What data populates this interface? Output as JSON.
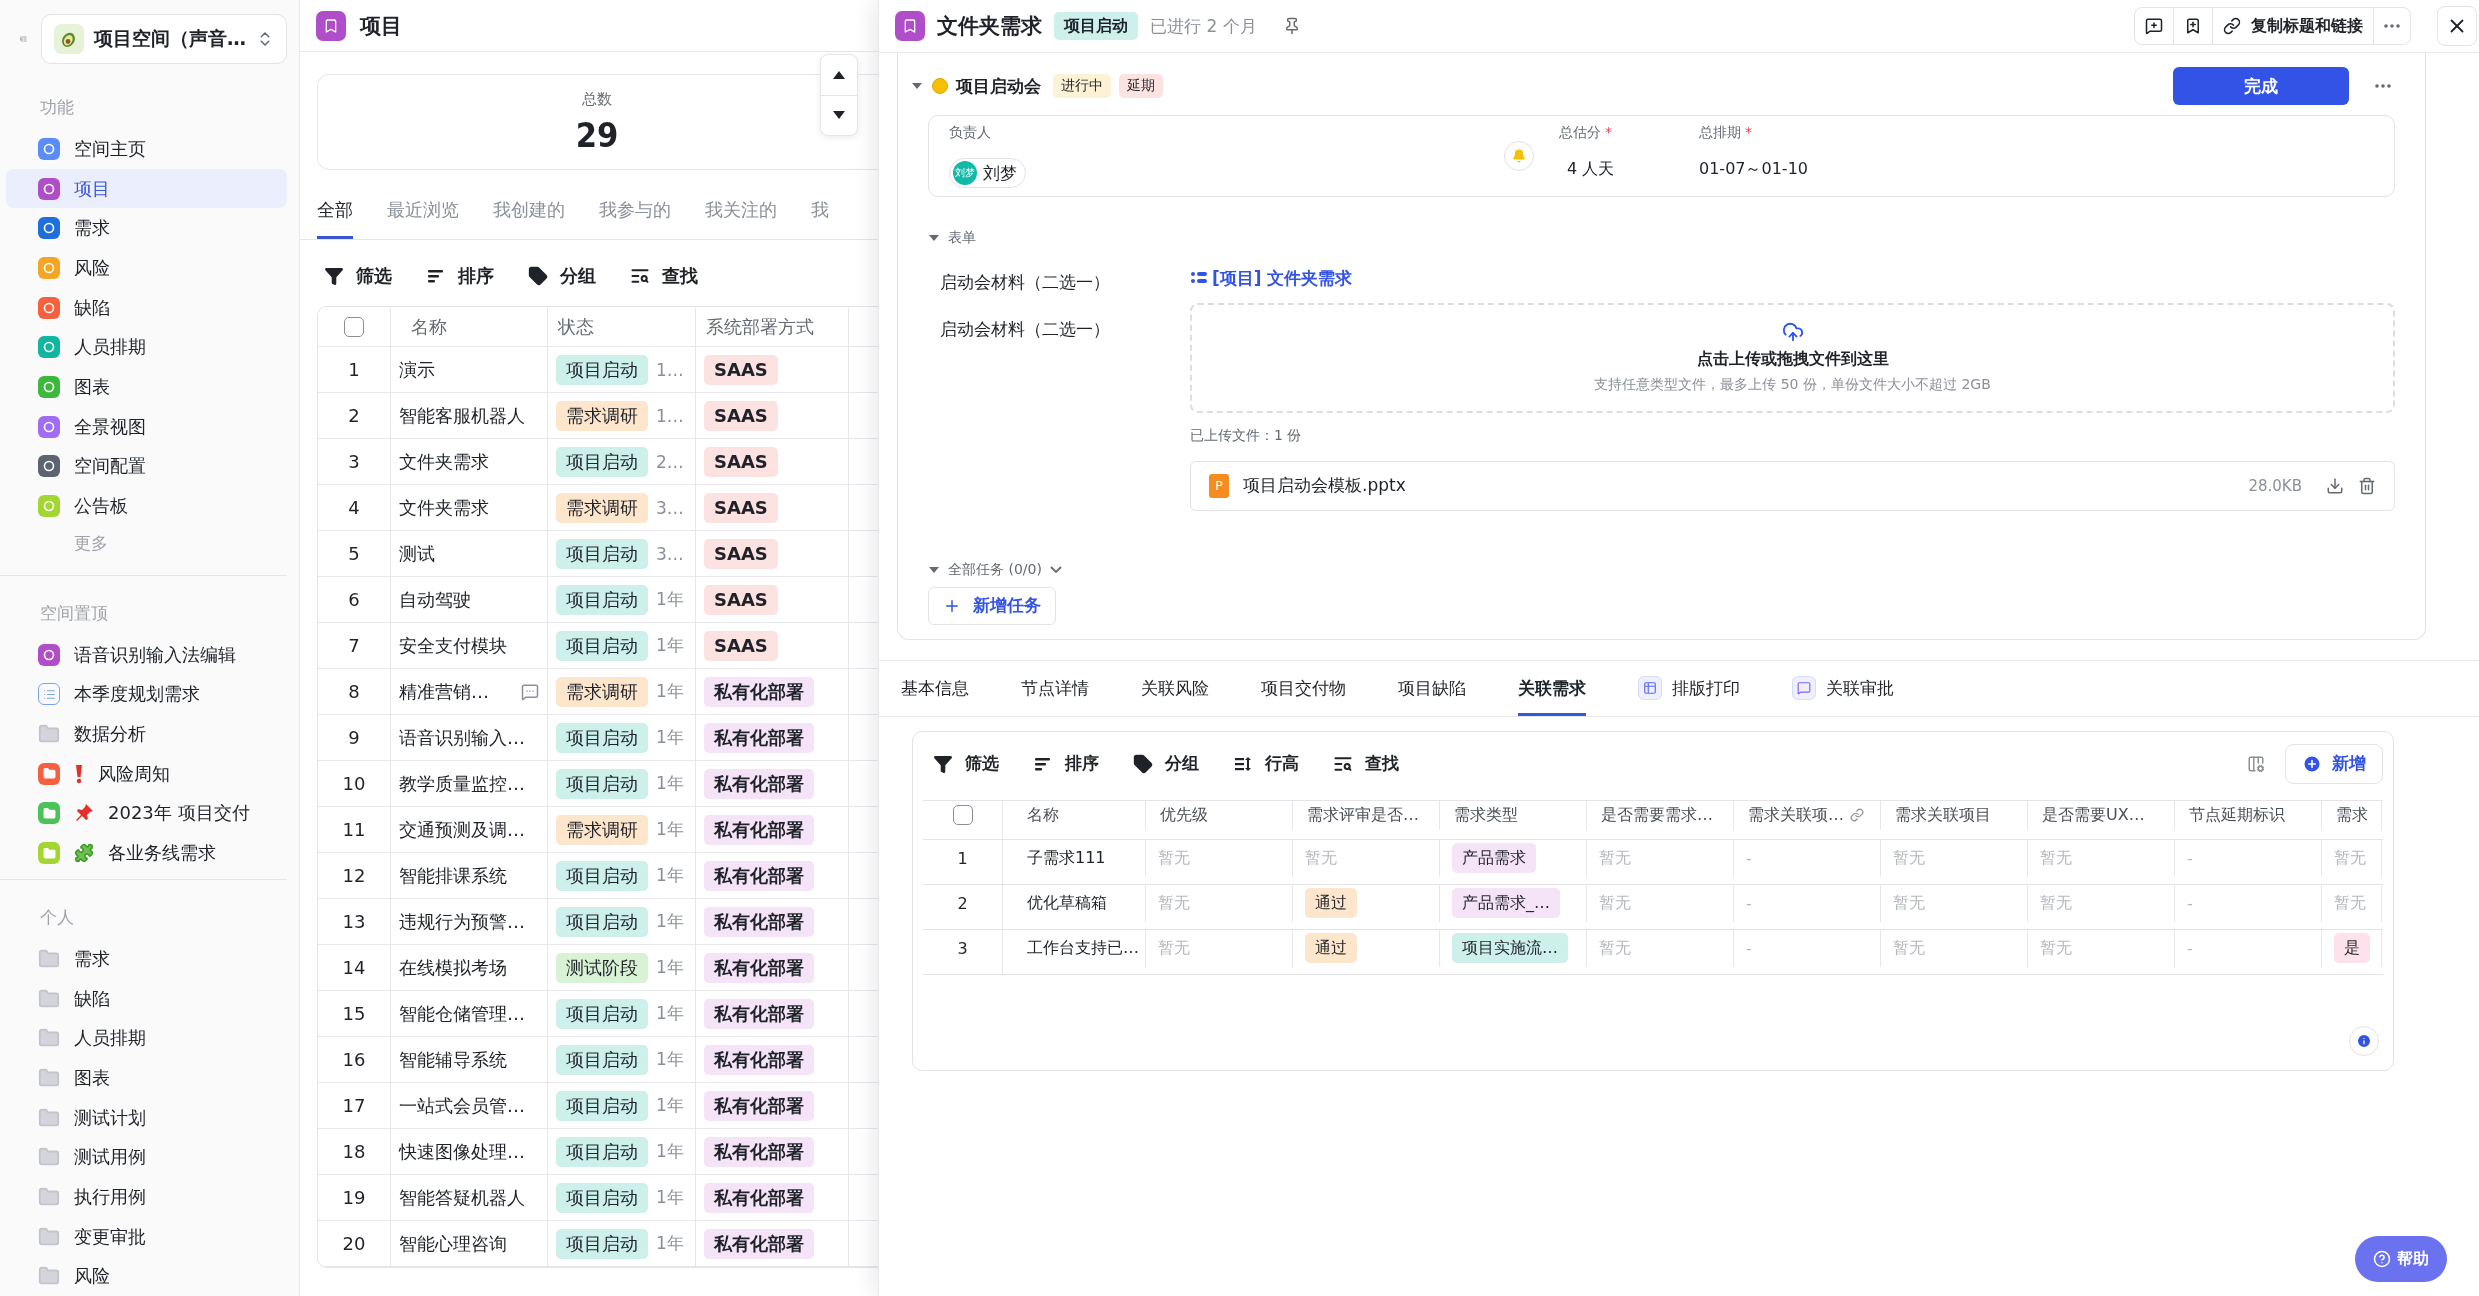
{
  "sidebar": {
    "space_selector": "项目空间（声音…",
    "sections": [
      {
        "title": "功能",
        "more": "更多",
        "items": [
          {
            "label": "空间主页",
            "kind": "app",
            "color": "#5b8cf7",
            "selected": false
          },
          {
            "label": "项目",
            "kind": "app",
            "color": "#b04ec9",
            "selected": true
          },
          {
            "label": "需求",
            "kind": "app",
            "color": "#1e6fd9",
            "selected": false
          },
          {
            "label": "风险",
            "kind": "app",
            "color": "#f5a524",
            "selected": false
          },
          {
            "label": "缺陷",
            "kind": "app",
            "color": "#f5603f",
            "selected": false
          },
          {
            "label": "人员排期",
            "kind": "app",
            "color": "#12b5a0",
            "selected": false
          },
          {
            "label": "图表",
            "kind": "app",
            "color": "#3cb93c",
            "selected": false
          },
          {
            "label": "全景视图",
            "kind": "app",
            "color": "#a06cf2",
            "selected": false
          },
          {
            "label": "空间配置",
            "kind": "app",
            "color": "#5d6470",
            "selected": false
          },
          {
            "label": "公告板",
            "kind": "app",
            "color": "#a3d631",
            "selected": false
          }
        ]
      },
      {
        "title": "空间置顶",
        "items": [
          {
            "label": "语音识别输入法编辑",
            "kind": "app",
            "color": "#b04ec9",
            "selected": false
          },
          {
            "label": "本季度规划需求",
            "kind": "list",
            "selected": false
          },
          {
            "label": "数据分析",
            "kind": "folder",
            "selected": false
          },
          {
            "label": "风险周知",
            "kind": "alert-folder",
            "color": "#f5603f",
            "selected": false
          },
          {
            "label": "2023年 项目交付",
            "kind": "pin-folder",
            "color": "#4cc25a",
            "selected": false
          },
          {
            "label": "各业务线需求",
            "kind": "puzzle-folder",
            "color": "#a3d631",
            "selected": false
          }
        ]
      },
      {
        "title": "个人",
        "items": [
          {
            "label": "需求",
            "kind": "folder",
            "selected": false
          },
          {
            "label": "缺陷",
            "kind": "folder",
            "selected": false
          },
          {
            "label": "人员排期",
            "kind": "folder",
            "selected": false
          },
          {
            "label": "图表",
            "kind": "folder",
            "selected": false
          },
          {
            "label": "测试计划",
            "kind": "folder",
            "selected": false
          },
          {
            "label": "测试用例",
            "kind": "folder",
            "selected": false
          },
          {
            "label": "执行用例",
            "kind": "folder",
            "selected": false
          },
          {
            "label": "变更审批",
            "kind": "folder",
            "selected": false
          },
          {
            "label": "风险",
            "kind": "folder",
            "selected": false
          }
        ]
      }
    ]
  },
  "project_list": {
    "title": "项目",
    "total_label": "总数",
    "total": "29",
    "tabs": [
      {
        "label": "全部",
        "selected": true
      },
      {
        "label": "最近浏览",
        "selected": false
      },
      {
        "label": "我创建的",
        "selected": false
      },
      {
        "label": "我参与的",
        "selected": false
      },
      {
        "label": "我关注的",
        "selected": false
      },
      {
        "label": "我",
        "selected": false
      }
    ],
    "toolbar": [
      {
        "label": "筛选",
        "kind": "filter"
      },
      {
        "label": "排序",
        "kind": "sort"
      },
      {
        "label": "分组",
        "kind": "group"
      },
      {
        "label": "查找",
        "kind": "find"
      }
    ],
    "table": {
      "all_checked": false,
      "columns": [
        "名称",
        "状态",
        "系统部署方式"
      ],
      "rows": [
        {
          "index": "1",
          "name": "演示",
          "commented": false,
          "status": {
            "label": "项目启动",
            "color": "#cdf0ea"
          },
          "duration": "1…",
          "deploy": {
            "label": "SAAS",
            "color": "#fde2e2"
          }
        },
        {
          "index": "2",
          "name": "智能客服机器人",
          "commented": false,
          "status": {
            "label": "需求调研",
            "color": "#fde6cc"
          },
          "duration": "1…",
          "deploy": {
            "label": "SAAS",
            "color": "#fde2e2"
          }
        },
        {
          "index": "3",
          "name": "文件夹需求",
          "commented": false,
          "status": {
            "label": "项目启动",
            "color": "#cdf0ea"
          },
          "duration": "2…",
          "deploy": {
            "label": "SAAS",
            "color": "#fde2e2"
          }
        },
        {
          "index": "4",
          "name": "文件夹需求",
          "commented": false,
          "status": {
            "label": "需求调研",
            "color": "#fde6cc"
          },
          "duration": "3…",
          "deploy": {
            "label": "SAAS",
            "color": "#fde2e2"
          }
        },
        {
          "index": "5",
          "name": "测试",
          "commented": false,
          "status": {
            "label": "项目启动",
            "color": "#cdf0ea"
          },
          "duration": "3…",
          "deploy": {
            "label": "SAAS",
            "color": "#fde2e2"
          }
        },
        {
          "index": "6",
          "name": "自动驾驶",
          "commented": false,
          "status": {
            "label": "项目启动",
            "color": "#cdf0ea"
          },
          "duration": "1年",
          "deploy": {
            "label": "SAAS",
            "color": "#fde2e2"
          }
        },
        {
          "index": "7",
          "name": "安全支付模块",
          "commented": false,
          "status": {
            "label": "项目启动",
            "color": "#cdf0ea"
          },
          "duration": "1年",
          "deploy": {
            "label": "SAAS",
            "color": "#fde2e2"
          }
        },
        {
          "index": "8",
          "name": "精准营销…",
          "commented": true,
          "status": {
            "label": "需求调研",
            "color": "#fde6cc"
          },
          "duration": "1年",
          "deploy": {
            "label": "私有化部署",
            "color": "#f5e3f7"
          }
        },
        {
          "index": "9",
          "name": "语音识别输入…",
          "commented": false,
          "status": {
            "label": "项目启动",
            "color": "#cdf0ea"
          },
          "duration": "1年",
          "deploy": {
            "label": "私有化部署",
            "color": "#f5e3f7"
          }
        },
        {
          "index": "10",
          "name": "教学质量监控…",
          "commented": false,
          "status": {
            "label": "项目启动",
            "color": "#cdf0ea"
          },
          "duration": "1年",
          "deploy": {
            "label": "私有化部署",
            "color": "#f5e3f7"
          }
        },
        {
          "index": "11",
          "name": "交通预测及调…",
          "commented": false,
          "status": {
            "label": "需求调研",
            "color": "#fde6cc"
          },
          "duration": "1年",
          "deploy": {
            "label": "私有化部署",
            "color": "#f5e3f7"
          }
        },
        {
          "index": "12",
          "name": "智能排课系统",
          "commented": false,
          "status": {
            "label": "项目启动",
            "color": "#cdf0ea"
          },
          "duration": "1年",
          "deploy": {
            "label": "私有化部署",
            "color": "#f5e3f7"
          }
        },
        {
          "index": "13",
          "name": "违规行为预警…",
          "commented": false,
          "status": {
            "label": "项目启动",
            "color": "#cdf0ea"
          },
          "duration": "1年",
          "deploy": {
            "label": "私有化部署",
            "color": "#f5e3f7"
          }
        },
        {
          "index": "14",
          "name": "在线模拟考场",
          "commented": false,
          "status": {
            "label": "测试阶段",
            "color": "#d9f2d5"
          },
          "duration": "1年",
          "deploy": {
            "label": "私有化部署",
            "color": "#f5e3f7"
          }
        },
        {
          "index": "15",
          "name": "智能仓储管理…",
          "commented": false,
          "status": {
            "label": "项目启动",
            "color": "#cdf0ea"
          },
          "duration": "1年",
          "deploy": {
            "label": "私有化部署",
            "color": "#f5e3f7"
          }
        },
        {
          "index": "16",
          "name": "智能辅导系统",
          "commented": false,
          "status": {
            "label": "项目启动",
            "color": "#cdf0ea"
          },
          "duration": "1年",
          "deploy": {
            "label": "私有化部署",
            "color": "#f5e3f7"
          }
        },
        {
          "index": "17",
          "name": "一站式会员管…",
          "commented": false,
          "status": {
            "label": "项目启动",
            "color": "#cdf0ea"
          },
          "duration": "1年",
          "deploy": {
            "label": "私有化部署",
            "color": "#f5e3f7"
          }
        },
        {
          "index": "18",
          "name": "快速图像处理…",
          "commented": false,
          "status": {
            "label": "项目启动",
            "color": "#cdf0ea"
          },
          "duration": "1年",
          "deploy": {
            "label": "私有化部署",
            "color": "#f5e3f7"
          }
        },
        {
          "index": "19",
          "name": "智能答疑机器人",
          "commented": false,
          "status": {
            "label": "项目启动",
            "color": "#cdf0ea"
          },
          "duration": "1年",
          "deploy": {
            "label": "私有化部署",
            "color": "#f5e3f7"
          }
        },
        {
          "index": "20",
          "name": "智能心理咨询",
          "commented": false,
          "status": {
            "label": "项目启动",
            "color": "#cdf0ea"
          },
          "duration": "1年",
          "deploy": {
            "label": "私有化部署",
            "color": "#f5e3f7"
          }
        }
      ]
    }
  },
  "detail": {
    "title": "文件夹需求",
    "status_tag": "项目启动",
    "elapsed": "已进行 2 个月",
    "copy_button": "复制标题和链接",
    "node": {
      "name": "项目启动会",
      "tags": [
        {
          "label": "进行中",
          "color": "#fdf1d6"
        },
        {
          "label": "延期",
          "color": "#fde2e2"
        }
      ],
      "complete_button": "完成",
      "owner_label": "负责人",
      "owner": "刘梦",
      "owner_avatar": "刘梦",
      "fields": [
        {
          "label": "总估分",
          "mark": "*",
          "value": "4 人天"
        },
        {
          "label": "总排期",
          "mark": "*",
          "value": "01-07～01-10"
        }
      ],
      "form_section": "表单",
      "form_labels": [
        "启动会材料（二选一）",
        "启动会材料（二选一）"
      ],
      "link": "[项目] 文件夹需求",
      "upload_title": "点击上传或拖拽文件到这里",
      "upload_hint": "支持任意类型文件，最多上传 50 份，单份文件大小不超过 2GB",
      "uploaded_label": "已上传文件：1 份",
      "file": {
        "badge": "P",
        "name": "项目启动会模板.pptx",
        "size": "28.0KB"
      },
      "tasks_label": "全部任务 (0/0)",
      "add_task": "新增任务"
    },
    "tabs": [
      {
        "label": "基本信息",
        "kind": "plain",
        "selected": false
      },
      {
        "label": "节点详情",
        "kind": "plain",
        "selected": false
      },
      {
        "label": "关联风险",
        "kind": "plain",
        "selected": false
      },
      {
        "label": "项目交付物",
        "kind": "plain",
        "selected": false
      },
      {
        "label": "项目缺陷",
        "kind": "plain",
        "selected": false
      },
      {
        "label": "关联需求",
        "kind": "plain",
        "selected": true
      },
      {
        "label": "排版打印",
        "kind": "print",
        "selected": false
      },
      {
        "label": "关联审批",
        "kind": "approval",
        "selected": false
      }
    ],
    "related": {
      "all_checked": false,
      "toolbar": [
        {
          "label": "筛选",
          "kind": "filter"
        },
        {
          "label": "排序",
          "kind": "sort"
        },
        {
          "label": "分组",
          "kind": "group"
        },
        {
          "label": "行高",
          "kind": "height"
        },
        {
          "label": "查找",
          "kind": "find"
        }
      ],
      "add_button": "新增",
      "columns": [
        {
          "label": "名称",
          "kind": "plain"
        },
        {
          "label": "优先级",
          "kind": "plain"
        },
        {
          "label": "需求评审是否…",
          "kind": "plain"
        },
        {
          "label": "需求类型",
          "kind": "plain"
        },
        {
          "label": "是否需要需求…",
          "kind": "plain"
        },
        {
          "label": "需求关联项…",
          "kind": "linked"
        },
        {
          "label": "需求关联项目",
          "kind": "plain"
        },
        {
          "label": "是否需要UX…",
          "kind": "plain"
        },
        {
          "label": "节点延期标识",
          "kind": "plain"
        },
        {
          "label": "需求",
          "kind": "plain"
        }
      ],
      "rows": [
        {
          "index": "1",
          "cells": [
            {
              "text": "子需求111",
              "kind": "text"
            },
            {
              "text": "暂无",
              "kind": "empty"
            },
            {
              "text": "暂无",
              "kind": "empty"
            },
            {
              "text": "产品需求",
              "kind": "tag",
              "color": "#f5e3f7"
            },
            {
              "text": "暂无",
              "kind": "empty"
            },
            {
              "text": "-",
              "kind": "empty"
            },
            {
              "text": "暂无",
              "kind": "empty"
            },
            {
              "text": "暂无",
              "kind": "empty"
            },
            {
              "text": "-",
              "kind": "empty"
            },
            {
              "text": "暂无",
              "kind": "empty"
            }
          ]
        },
        {
          "index": "2",
          "cells": [
            {
              "text": "优化草稿箱",
              "kind": "text"
            },
            {
              "text": "暂无",
              "kind": "empty"
            },
            {
              "text": "通过",
              "kind": "tag",
              "color": "#fde6cc"
            },
            {
              "text": "产品需求_…",
              "kind": "tag",
              "color": "#f5e3f7"
            },
            {
              "text": "暂无",
              "kind": "empty"
            },
            {
              "text": "-",
              "kind": "empty"
            },
            {
              "text": "暂无",
              "kind": "empty"
            },
            {
              "text": "暂无",
              "kind": "empty"
            },
            {
              "text": "-",
              "kind": "empty"
            },
            {
              "text": "暂无",
              "kind": "empty"
            }
          ]
        },
        {
          "index": "3",
          "cells": [
            {
              "text": "工作台支持已…",
              "kind": "text"
            },
            {
              "text": "暂无",
              "kind": "empty"
            },
            {
              "text": "通过",
              "kind": "tag",
              "color": "#fde6cc"
            },
            {
              "text": "项目实施流…",
              "kind": "tag",
              "color": "#cdf0ea"
            },
            {
              "text": "暂无",
              "kind": "empty"
            },
            {
              "text": "-",
              "kind": "empty"
            },
            {
              "text": "暂无",
              "kind": "empty"
            },
            {
              "text": "暂无",
              "kind": "empty"
            },
            {
              "text": "-",
              "kind": "empty"
            },
            {
              "text": "是",
              "kind": "tag",
              "color": "#fde2ec"
            }
          ]
        }
      ]
    }
  },
  "help_button": "帮助"
}
